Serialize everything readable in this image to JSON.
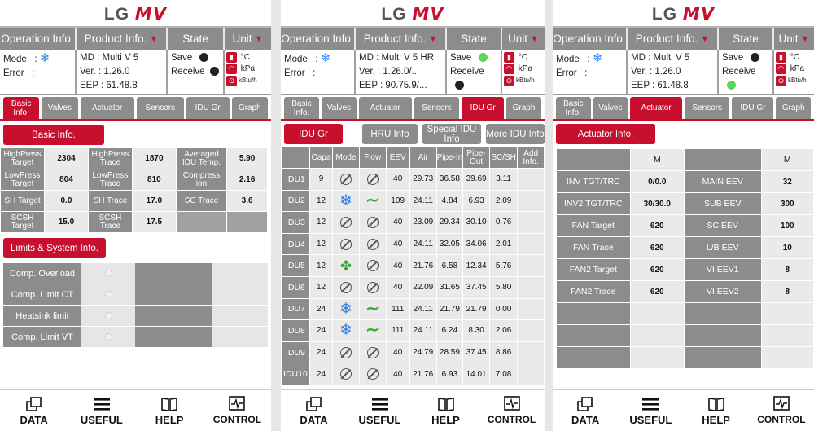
{
  "logo": {
    "lg": "LG",
    "mv": "MV"
  },
  "header": {
    "operation": "Operation Info.",
    "product": "Product Info.",
    "state": "State",
    "unit": "Unit"
  },
  "labels": {
    "mode": "Mode",
    "error": "Error",
    "save": "Save",
    "receive": "Receive",
    "celsius": "°C",
    "kpa": "kPa",
    "kbtu": "kBtu/h"
  },
  "tabs": [
    "Basic Info.",
    "Valves",
    "Actuator",
    "Sensors",
    "IDU Gr",
    "Graph"
  ],
  "footer": [
    "DATA",
    "USEFUL",
    "HELP",
    "CONTROL"
  ],
  "panel1": {
    "md": "MD : Multi V 5",
    "ver": "Ver. : 1.26.0",
    "eep": "EEP : 61.48.8",
    "basic_info_btn": "Basic Info.",
    "basic_rows": [
      [
        "HighPress Target",
        "2304",
        "HighPress Trace",
        "1870",
        "Averaged IDU Temp.",
        "5.90"
      ],
      [
        "LowPress Target",
        "804",
        "LowPress Trace",
        "810",
        "Compress ion",
        "2.16"
      ],
      [
        "SH Target",
        "0.0",
        "SH Trace",
        "17.0",
        "SC Trace",
        "3.6"
      ],
      [
        "SCSH Target",
        "15.0",
        "SCSH Trace",
        "17.5",
        "",
        ""
      ]
    ],
    "limits_btn": "Limits & System Info.",
    "limits": [
      "Comp. Overload",
      "Comp. Limit CT",
      "Heatsink limit",
      "Comp. Limit VT"
    ]
  },
  "panel2": {
    "md": "MD : Multi V 5 HR",
    "ver": "Ver. : 1.26.0/...",
    "eep": "EEP : 90.75.9/...",
    "sub_buttons": [
      "IDU Gr",
      "HRU Info",
      "Special IDU Info",
      "More IDU Info"
    ],
    "columns": [
      "",
      "Capa",
      "Mode",
      "Flow",
      "EEV",
      "Air",
      "Pipe-In",
      "Pipe-Out",
      "SC/SH",
      "Add Info."
    ],
    "rows": [
      {
        "name": "IDU1",
        "capa": "9",
        "mode": "off",
        "flow": "off",
        "eev": "40",
        "air": "29.73",
        "pin": "36.58",
        "pout": "39.69",
        "scsh": "3.11"
      },
      {
        "name": "IDU2",
        "capa": "12",
        "mode": "cool",
        "flow": "wave",
        "eev": "109",
        "air": "24.11",
        "pin": "4.84",
        "pout": "6.93",
        "scsh": "2.09"
      },
      {
        "name": "IDU3",
        "capa": "12",
        "mode": "off",
        "flow": "off",
        "eev": "40",
        "air": "23.09",
        "pin": "29.34",
        "pout": "30.10",
        "scsh": "0.76"
      },
      {
        "name": "IDU4",
        "capa": "12",
        "mode": "off",
        "flow": "off",
        "eev": "40",
        "air": "24.11",
        "pin": "32.05",
        "pout": "34.06",
        "scsh": "2.01"
      },
      {
        "name": "IDU5",
        "capa": "12",
        "mode": "fan",
        "flow": "off",
        "eev": "40",
        "air": "21.76",
        "pin": "6.58",
        "pout": "12.34",
        "scsh": "5.76"
      },
      {
        "name": "IDU6",
        "capa": "12",
        "mode": "off",
        "flow": "off",
        "eev": "40",
        "air": "22.09",
        "pin": "31.65",
        "pout": "37.45",
        "scsh": "5.80"
      },
      {
        "name": "IDU7",
        "capa": "24",
        "mode": "cool",
        "flow": "wave",
        "eev": "111",
        "air": "24.11",
        "pin": "21.79",
        "pout": "21.79",
        "scsh": "0.00"
      },
      {
        "name": "IDU8",
        "capa": "24",
        "mode": "cool",
        "flow": "wave",
        "eev": "111",
        "air": "24.11",
        "pin": "6.24",
        "pout": "8.30",
        "scsh": "2.06"
      },
      {
        "name": "IDU9",
        "capa": "24",
        "mode": "off",
        "flow": "off",
        "eev": "40",
        "air": "24.79",
        "pin": "28.59",
        "pout": "37.45",
        "scsh": "8.86"
      },
      {
        "name": "IDU10",
        "capa": "24",
        "mode": "off",
        "flow": "off",
        "eev": "40",
        "air": "21.76",
        "pin": "6.93",
        "pout": "14.01",
        "scsh": "7.08"
      }
    ]
  },
  "panel3": {
    "md": "MD : Multi V 5",
    "ver": "Ver. : 1.26.0",
    "eep": "EEP : 61.48.8",
    "actuator_btn": "Actuator Info.",
    "col_m": "M",
    "rows": [
      [
        "INV TGT/TRC",
        "0/0.0",
        "MAIN EEV",
        "32"
      ],
      [
        "INV2 TGT/TRC",
        "30/30.0",
        "SUB EEV",
        "300"
      ],
      [
        "FAN Target",
        "620",
        "SC EEV",
        "100"
      ],
      [
        "FAN Trace",
        "620",
        "L/B EEV",
        "10"
      ],
      [
        "FAN2 Target",
        "620",
        "VI EEV1",
        "8"
      ],
      [
        "FAN2 Trace",
        "620",
        "VI EEV2",
        "8"
      ]
    ]
  },
  "colors": {
    "accent": "#c8102e",
    "grey": "#8c8c8c",
    "cool": "#2a7de1",
    "fan": "#3aaa3a"
  }
}
